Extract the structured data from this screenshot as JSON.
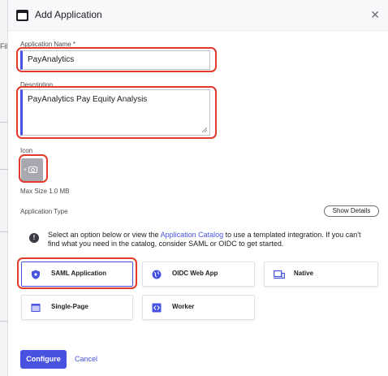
{
  "background": {
    "partial_text": "Fil"
  },
  "modal": {
    "title": "Add Application",
    "close_icon": "close-icon",
    "app_name": {
      "label": "Application Name *",
      "value": "PayAnalytics"
    },
    "description": {
      "label": "Description",
      "value": "PayAnalytics Pay Equity Analysis"
    },
    "icon_section": {
      "label": "Icon",
      "max_size": "Max Size 1.0 MB"
    },
    "app_type": {
      "label": "Application Type",
      "show_details": "Show Details",
      "info_before_link": "Select an option below or view the ",
      "info_link": "Application Catalog",
      "info_after_link": " to use a templated integration. If you can't find what you need in the catalog, consider SAML or OIDC to get started.",
      "options": [
        {
          "label": "SAML Application",
          "icon": "shield-icon",
          "selected": true
        },
        {
          "label": "OIDC Web App",
          "icon": "globe-icon",
          "selected": false
        },
        {
          "label": "Native",
          "icon": "devices-icon",
          "selected": false
        },
        {
          "label": "Single-Page",
          "icon": "browser-window-icon",
          "selected": false
        },
        {
          "label": "Worker",
          "icon": "code-icon",
          "selected": false
        }
      ]
    },
    "buttons": {
      "configure": "Configure",
      "cancel": "Cancel"
    }
  },
  "colors": {
    "accent": "#4753e0",
    "annotation": "#e23b2d"
  }
}
